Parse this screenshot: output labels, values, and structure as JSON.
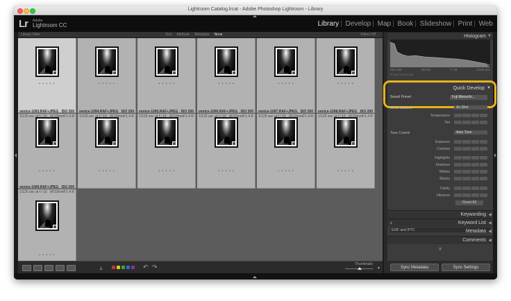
{
  "window": {
    "title": "Lightroom Catalog.lrcat - Adobe Photoshop Lightroom - Library"
  },
  "identity": {
    "logo": "Lr",
    "adobe": "Adobe",
    "product": "Lightroom CC"
  },
  "modules": [
    "Library",
    "Develop",
    "Map",
    "Book",
    "Slideshow",
    "Print",
    "Web"
  ],
  "active_module": "Library",
  "filter_bar": {
    "title": "Library Filter :",
    "options": [
      "Text",
      "Attribute",
      "Metadata",
      "None"
    ],
    "active": "None",
    "right": "Filters Off"
  },
  "grid": {
    "top_row": [
      {
        "file": "venice-1093.RAF+JPEG",
        "iso": "ISO 200",
        "exposure": "1/125 sec at f / 16",
        "lens": "XF23mmF1.4 R"
      },
      {
        "file": "venice-1094.RAF+JPEG",
        "iso": "ISO 200",
        "exposure": "1/125 sec at f / 16",
        "lens": "XF23mmF1.4 R"
      },
      {
        "file": "venice-1095.RAF+JPEG",
        "iso": "ISO 200",
        "exposure": "1/125 sec at f / 16",
        "lens": "XF23mmF1.4 R"
      },
      {
        "file": "venice-1096.RAF+JPEG",
        "iso": "ISO 200",
        "exposure": "1/125 sec at f / 16",
        "lens": "XF23mmF1.4 R"
      },
      {
        "file": "venice-1097.RAF+JPEG",
        "iso": "ISO 200",
        "exposure": "1/125 sec at f / 16",
        "lens": "XF23mmF1.4 R"
      },
      {
        "file": "venice-1098.RAF+JPEG",
        "iso": "ISO 200",
        "exposure": "1/125 sec at f / 16",
        "lens": "XF23mmF1.4 R"
      }
    ],
    "bottom_row": [
      {
        "file": "venice-1099.RAF+JPEG",
        "iso": "ISO 200",
        "exposure": "1/125 sec at f / 16",
        "lens": "XF23mmF1.4 R"
      }
    ],
    "dots": "• • • • •"
  },
  "toolbar": {
    "thumbnails_label": "Thumbnails",
    "sort_glyph": "⤓",
    "rotate_left": "↶",
    "rotate_right": "↷",
    "swatch_colors": [
      "#c33",
      "#cc3",
      "#3a3",
      "#36c",
      "#839"
    ]
  },
  "histogram": {
    "title": "Histogram",
    "iso": "ISO 200",
    "focal": "23 mm",
    "aperture": "f / 16",
    "shutter": "1/125 sec",
    "icons": "□ 1:1 □ 1:1 □ 1:1"
  },
  "quick_develop": {
    "title": "Quick Develop",
    "saved_preset_label": "Saved Preset",
    "saved_preset_value": "Fuji Monochr...",
    "white_balance_label": "White Balance",
    "white_balance_value": "As Shot",
    "temperature": "Temperature",
    "tint": "Tint",
    "tone_control": "Tone Control",
    "auto_tone": "Auto Tone",
    "exposure": "Exposure",
    "contrast": "Contrast",
    "highlights": "Highlights",
    "shadows": "Shadows",
    "whites": "Whites",
    "blacks": "Blacks",
    "clarity": "Clarity",
    "vibrance": "Vibrance",
    "reset": "Reset All"
  },
  "panels": {
    "keywording": "Keywording",
    "keyword_list": "Keyword List",
    "metadata": "Metadata",
    "comments": "Comments",
    "exif": "EXIF and IPTC",
    "ornament": "❦"
  },
  "bottom_buttons": {
    "sync_metadata": "Sync Metadata",
    "sync_settings": "Sync Settings"
  }
}
